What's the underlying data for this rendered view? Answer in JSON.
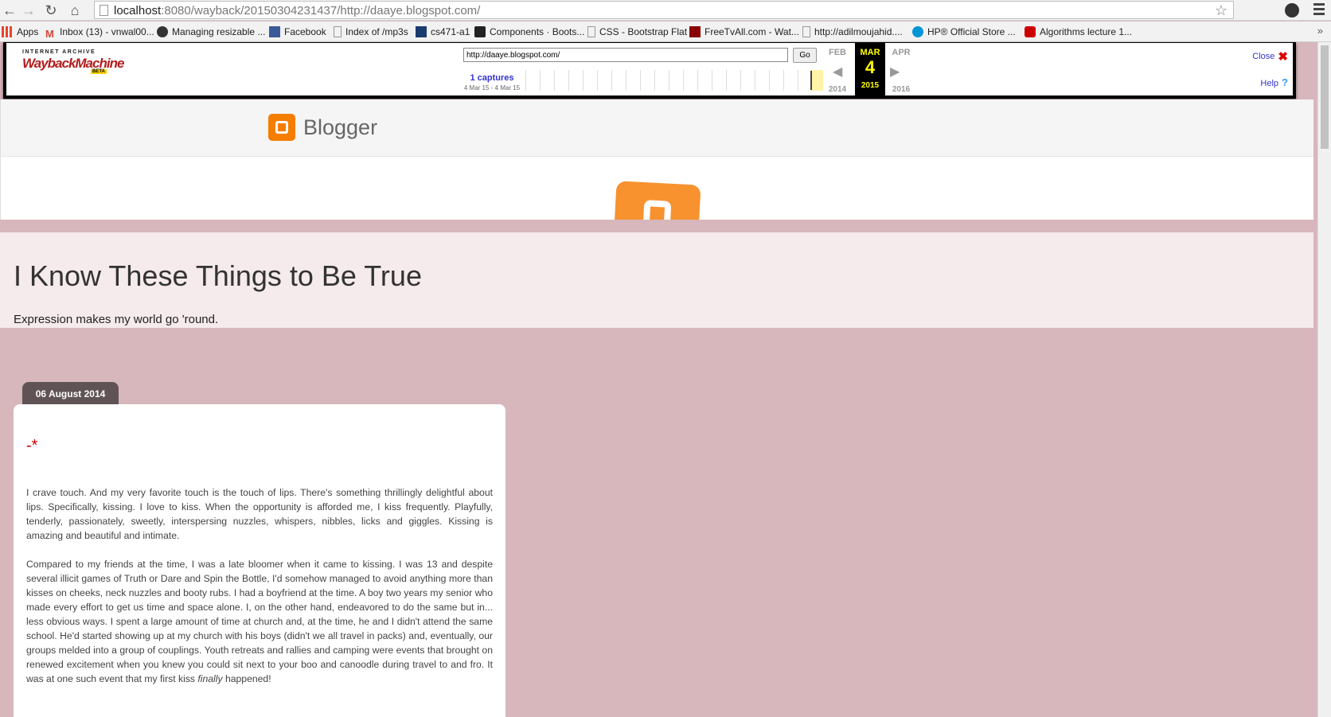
{
  "browser": {
    "url_host": "localhost",
    "url_rest": ":8080/wayback/20150304231437/http://daaye.blogspot.com/",
    "bookmarks": [
      {
        "label": "Apps",
        "icon": "apps-grid-icon",
        "color": "#e8452c"
      },
      {
        "label": "Inbox (13) - vnwal00...",
        "icon": "gmail-icon",
        "color": "#d44638"
      },
      {
        "label": "Managing resizable ...",
        "icon": "globe-icon",
        "color": "#333333"
      },
      {
        "label": "Facebook",
        "icon": "facebook-icon",
        "color": "#3b5998"
      },
      {
        "label": "Index of /mp3s",
        "icon": "page-icon",
        "color": "#999999"
      },
      {
        "label": "cs471-a1",
        "icon": "cs-icon",
        "color": "#1a3b6e"
      },
      {
        "label": "Components · Boots...",
        "icon": "bootstrap-icon",
        "color": "#222222"
      },
      {
        "label": "CSS - Bootstrap Flat",
        "icon": "page-icon",
        "color": "#999999"
      },
      {
        "label": "FreeTvAll.com - Wat...",
        "icon": "freetv-icon",
        "color": "#8b0000"
      },
      {
        "label": "http://adilmoujahid....",
        "icon": "page-icon",
        "color": "#999999"
      },
      {
        "label": "HP® Official Store ...",
        "icon": "hp-icon",
        "color": "#0096d6"
      },
      {
        "label": "Algorithms lecture 1...",
        "icon": "youtube-icon",
        "color": "#cc0000"
      }
    ],
    "more": "»"
  },
  "wayback": {
    "logo_top": "INTERNET ARCHIVE",
    "logo_main": "WaybackMachine",
    "logo_beta": "BETA",
    "url_value": "http://daaye.blogspot.com/",
    "go_label": "Go",
    "captures_label": "1 captures",
    "captures_range": "4 Mar 15 - 4 Mar 15",
    "prev_month": "FEB",
    "prev_year": "2014",
    "cur_month": "MAR",
    "cur_day": "4",
    "cur_year": "2015",
    "next_month": "APR",
    "next_year": "2016",
    "close_label": "Close",
    "help_label": "Help"
  },
  "blogger": {
    "wordmark": "Blogger"
  },
  "blog": {
    "title": "I Know These Things to Be True",
    "description": "Expression makes my world go 'round."
  },
  "post": {
    "date": "06 August 2014",
    "title": "-*",
    "para1": "I crave touch. And my very favorite touch is the touch of lips. There's something thrillingly delightful about lips. Specifically, kissing. I love to kiss. When the opportunity is afforded me, I kiss frequently. Playfully, tenderly, passionately, sweetly, interspersing nuzzles, whispers, nibbles, licks and giggles. Kissing is amazing and beautiful and intimate.",
    "para2_a": "Compared to my friends at the time, I was a late bloomer when it came to kissing. I was 13 and despite several illicit games of Truth or Dare and Spin the Bottle, I'd somehow managed to avoid anything more than kisses on cheeks, neck nuzzles and booty rubs. I had a boyfriend at the time. A boy two years my senior who made every effort to get us time and space alone. I, on the other hand, endeavored to do the same but in... less obvious ways. I spent a large amount of time at church and, at the time, he and I didn't attend the same school. He'd started showing up at my church with his boys (didn't we all travel in packs) and, eventually, our groups melded into a group of couplings. Youth retreats and rallies and camping were events that brought on renewed excitement when you knew you could sit next to your boo and canoodle during travel to and fro. It was at one such event that my first kiss ",
    "para2_em": "finally",
    "para2_b": " happened!"
  }
}
